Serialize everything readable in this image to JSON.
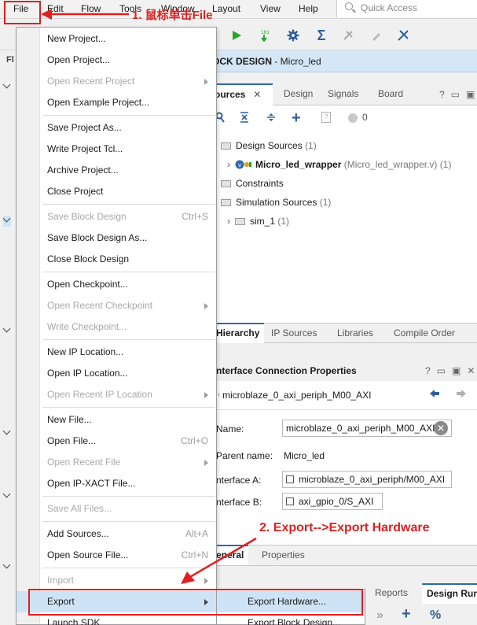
{
  "menubar": {
    "items": [
      "File",
      "Edit",
      "Flow",
      "Tools",
      "Window",
      "Layout",
      "View",
      "Help"
    ],
    "search_placeholder": "Quick Access"
  },
  "diagram": {
    "title_prefix": "OCK DESIGN",
    "title_suffix": " - Micro_led"
  },
  "sources": {
    "tabs": [
      "ources",
      "Design",
      "Signals",
      "Board"
    ],
    "count_badge": "0",
    "tree": [
      {
        "label": "Design Sources",
        "count": "(1)"
      },
      {
        "label": "Micro_led_wrapper",
        "detail": "(Micro_led_wrapper.v)",
        "count": "(1)"
      },
      {
        "label": "Constraints"
      },
      {
        "label": "Simulation Sources",
        "count": "(1)"
      },
      {
        "label": "sim_1",
        "count": "(1)"
      }
    ],
    "bottom_tabs": [
      "Hierarchy",
      "IP Sources",
      "Libraries",
      "Compile Order"
    ]
  },
  "interface_props": {
    "title": "nterface Connection Properties",
    "object_name": "microblaze_0_axi_periph_M00_AXI",
    "name_label": "Name:",
    "name_value": "microblaze_0_axi_periph_M00_AXI",
    "parent_label": "Parent name:",
    "parent_value": "Micro_led",
    "iface_a_label": "nterface A:",
    "iface_a_value": "microblaze_0_axi_periph/M00_AXI",
    "iface_b_label": "nterface B:",
    "iface_b_value": "axi_gpio_0/S_AXI",
    "tabs": [
      "eneral",
      "Properties"
    ]
  },
  "lower_tabs": [
    "Reports",
    "Design Run"
  ],
  "file_menu": {
    "items": [
      {
        "label": "New Project...",
        "shortcut": "",
        "enabled": true,
        "submenu": false
      },
      {
        "label": "Open Project...",
        "shortcut": "",
        "enabled": true,
        "submenu": false
      },
      {
        "label": "Open Recent Project",
        "shortcut": "",
        "enabled": false,
        "submenu": true
      },
      {
        "label": "Open Example Project...",
        "shortcut": "",
        "enabled": true,
        "submenu": false
      },
      {
        "label": "Save Project As...",
        "shortcut": "",
        "enabled": true,
        "submenu": false
      },
      {
        "label": "Write Project Tcl...",
        "shortcut": "",
        "enabled": true,
        "submenu": false
      },
      {
        "label": "Archive Project...",
        "shortcut": "",
        "enabled": true,
        "submenu": false
      },
      {
        "label": "Close Project",
        "shortcut": "",
        "enabled": true,
        "submenu": false
      },
      {
        "label": "Save Block Design",
        "shortcut": "Ctrl+S",
        "enabled": false,
        "submenu": false
      },
      {
        "label": "Save Block Design As...",
        "shortcut": "",
        "enabled": true,
        "submenu": false
      },
      {
        "label": "Close Block Design",
        "shortcut": "",
        "enabled": true,
        "submenu": false
      },
      {
        "label": "Open Checkpoint...",
        "shortcut": "",
        "enabled": true,
        "submenu": false
      },
      {
        "label": "Open Recent Checkpoint",
        "shortcut": "",
        "enabled": false,
        "submenu": true
      },
      {
        "label": "Write Checkpoint...",
        "shortcut": "",
        "enabled": false,
        "submenu": false
      },
      {
        "label": "New IP Location...",
        "shortcut": "",
        "enabled": true,
        "submenu": false
      },
      {
        "label": "Open IP Location...",
        "shortcut": "",
        "enabled": true,
        "submenu": false
      },
      {
        "label": "Open Recent IP Location",
        "shortcut": "",
        "enabled": false,
        "submenu": true
      },
      {
        "label": "New File...",
        "shortcut": "",
        "enabled": true,
        "submenu": false
      },
      {
        "label": "Open File...",
        "shortcut": "Ctrl+O",
        "enabled": true,
        "submenu": false
      },
      {
        "label": "Open Recent File",
        "shortcut": "",
        "enabled": false,
        "submenu": true
      },
      {
        "label": "Open IP-XACT File...",
        "shortcut": "",
        "enabled": true,
        "submenu": false
      },
      {
        "label": "Save All Files...",
        "shortcut": "",
        "enabled": false,
        "submenu": false
      },
      {
        "label": "Add Sources...",
        "shortcut": "Alt+A",
        "enabled": true,
        "submenu": false
      },
      {
        "label": "Open Source File...",
        "shortcut": "Ctrl+N",
        "enabled": true,
        "submenu": false
      },
      {
        "label": "Import",
        "shortcut": "",
        "enabled": false,
        "submenu": true
      },
      {
        "label": "Export",
        "shortcut": "",
        "enabled": true,
        "submenu": true
      },
      {
        "label": "Launch SDK",
        "shortcut": "",
        "enabled": true,
        "submenu": false
      }
    ]
  },
  "export_submenu": {
    "items": [
      "Export Hardware...",
      "Export Block Design..."
    ]
  },
  "annotations": {
    "step1": "1. 鼠标单击File",
    "step2": "2. Export-->Export Hardware"
  },
  "colors": {
    "annotation_red": "#e02020",
    "menu_highlight": "#cfe3f6",
    "diagram_title_bg": "#d5e7f7",
    "run_green": "#2aa52a",
    "icon_blue": "#2f5f9a"
  },
  "icons": [
    "search-icon",
    "run-icon",
    "step-run-icon",
    "gear-icon",
    "sigma-icon",
    "collapse-all-icon",
    "expand-all-icon",
    "add-icon",
    "folder-icon",
    "verilog-file-icon",
    "back-arrow-icon",
    "forward-arrow-icon",
    "close-icon",
    "chevron-down-icon"
  ]
}
